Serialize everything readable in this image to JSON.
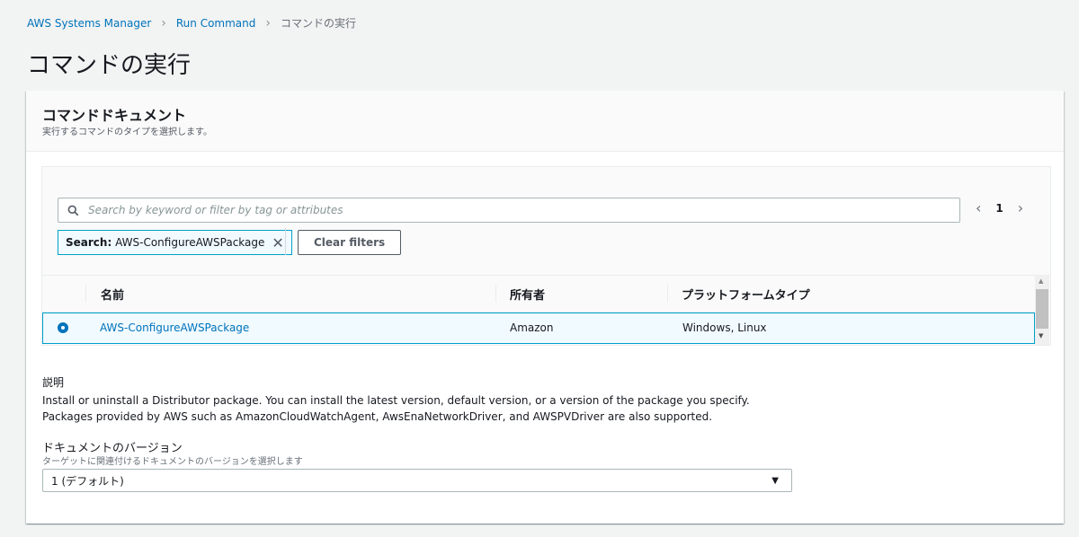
{
  "breadcrumb": {
    "items": [
      "AWS Systems Manager",
      "Run Command"
    ],
    "current": "コマンドの実行"
  },
  "page_title": "コマンドの実行",
  "panel": {
    "title": "コマンドドキュメント",
    "description": "実行するコマンドのタイプを選択します。"
  },
  "search": {
    "placeholder": "Search by keyword or filter by tag or attributes",
    "value": ""
  },
  "pagination": {
    "prev": "‹",
    "page": "1",
    "next": "›"
  },
  "filter_token": {
    "label": "Search:",
    "value": "AWS-ConfigureAWSPackage"
  },
  "clear_filters_label": "Clear filters",
  "table": {
    "columns": [
      "名前",
      "所有者",
      "プラットフォームタイプ"
    ],
    "rows": [
      {
        "name": "AWS-ConfigureAWSPackage",
        "owner": "Amazon",
        "platform": "Windows, Linux",
        "selected": true
      }
    ]
  },
  "details": {
    "label": "説明",
    "text": "Install or uninstall a Distributor package. You can install the latest version, default version, or a version of the package you specify. Packages provided by AWS such as AmazonCloudWatchAgent, AwsEnaNetworkDriver, and AWSPVDriver are also supported."
  },
  "version": {
    "label": "ドキュメントのバージョン",
    "sublabel": "ターゲットに関連付けるドキュメントのバージョンを選択します",
    "selected": "1 (デフォルト)"
  },
  "colors": {
    "link": "#0073bb",
    "selection_border": "#00a1c9",
    "selection_bg": "#f1faff"
  }
}
